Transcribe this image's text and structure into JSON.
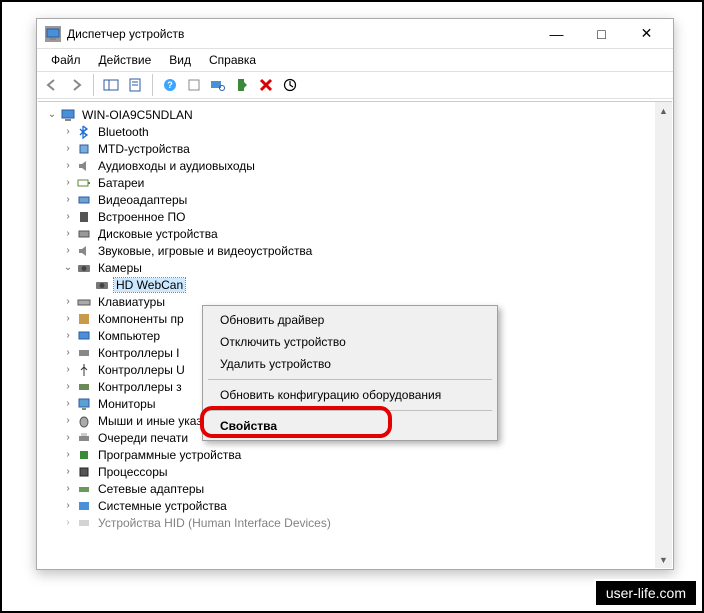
{
  "window": {
    "title": "Диспетчер устройств"
  },
  "menubar": {
    "file": "Файл",
    "action": "Действие",
    "view": "Вид",
    "help": "Справка"
  },
  "tree": {
    "root": "WIN-OIA9C5NDLAN",
    "items": [
      "Bluetooth",
      "MTD-устройства",
      "Аудиовходы и аудиовыходы",
      "Батареи",
      "Видеоадаптеры",
      "Встроенное ПО",
      "Дисковые устройства",
      "Звуковые, игровые и видеоустройства",
      "Камеры",
      "Клавиатуры",
      "Компоненты пр",
      "Компьютер",
      "Контроллеры I",
      "Контроллеры U",
      "Контроллеры з",
      "Мониторы",
      "Мыши и иные указывающие устройства",
      "Очереди печати",
      "Программные устройства",
      "Процессоры",
      "Сетевые адаптеры",
      "Системные устройства",
      "Устройства HID (Human Interface Devices)"
    ],
    "camera_child": "HD WebCan"
  },
  "context_menu": {
    "update_driver": "Обновить драйвер",
    "disable": "Отключить устройство",
    "uninstall": "Удалить устройство",
    "scan": "Обновить конфигурацию оборудования",
    "properties": "Свойства"
  },
  "watermark": "user-life.com"
}
